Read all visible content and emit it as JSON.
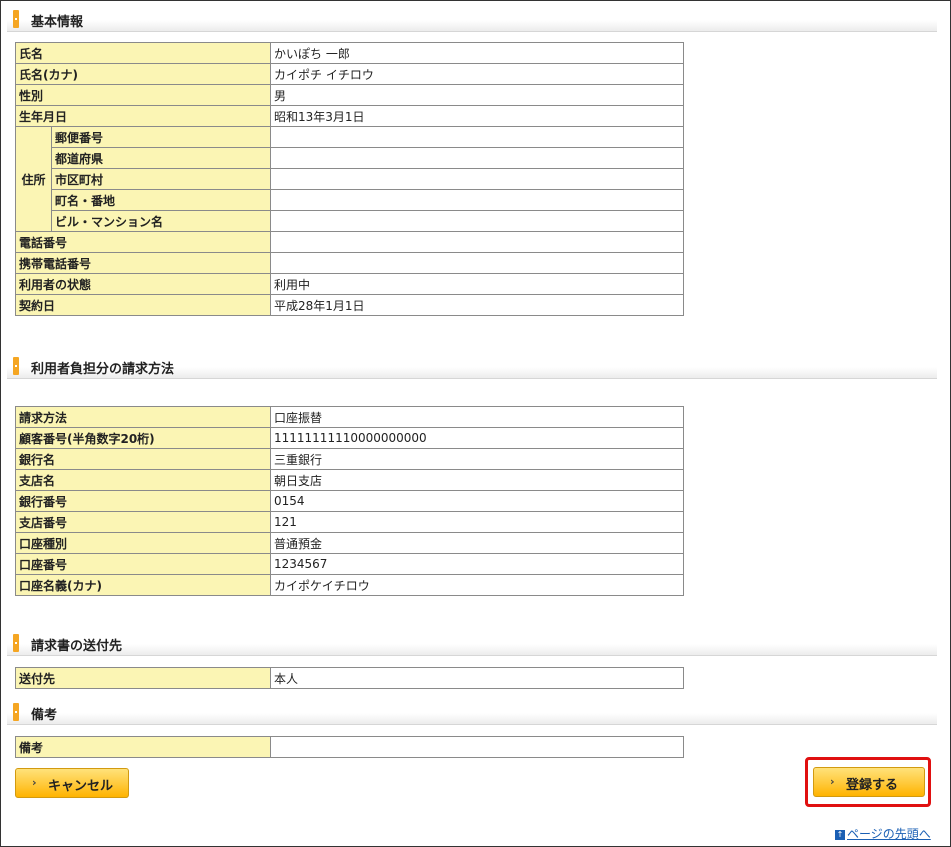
{
  "sections": {
    "basic": {
      "title": "基本情報",
      "name_label": "氏名",
      "name_value": "かいぽち 一郎",
      "kana_label": "氏名(カナ)",
      "kana_value": "カイポチ イチロウ",
      "gender_label": "性別",
      "gender_value": "男",
      "birth_label": "生年月日",
      "birth_value": "昭和13年3月1日",
      "address_label": "住所",
      "postal_label": "郵便番号",
      "postal_value": "",
      "prefecture_label": "都道府県",
      "prefecture_value": "",
      "city_label": "市区町村",
      "city_value": "",
      "town_label": "町名・番地",
      "town_value": "",
      "building_label": "ビル・マンション名",
      "building_value": "",
      "phone_label": "電話番号",
      "phone_value": "",
      "mobile_label": "携帯電話番号",
      "mobile_value": "",
      "status_label": "利用者の状態",
      "status_value": "利用中",
      "contract_label": "契約日",
      "contract_value": "平成28年1月1日"
    },
    "billing": {
      "title": "利用者負担分の請求方法",
      "method_label": "請求方法",
      "method_value": "口座振替",
      "customer_label": "顧客番号(半角数字20桁)",
      "customer_value": "11111111110000000000",
      "bank_label": "銀行名",
      "bank_value": "三重銀行",
      "branch_label": "支店名",
      "branch_value": "朝日支店",
      "bank_no_label": "銀行番号",
      "bank_no_value": "0154",
      "branch_no_label": "支店番号",
      "branch_no_value": "121",
      "account_type_label": "口座種別",
      "account_type_value": "普通預金",
      "account_no_label": "口座番号",
      "account_no_value": "1234567",
      "account_name_label": "口座名義(カナ)",
      "account_name_value": "カイポケイチロウ"
    },
    "invoice": {
      "title": "請求書の送付先",
      "dest_label": "送付先",
      "dest_value": "本人"
    },
    "remarks": {
      "title": "備考",
      "remarks_label": "備考",
      "remarks_value": ""
    }
  },
  "buttons": {
    "cancel_label": "キャンセル",
    "register_label": "登録する",
    "chevron": "›"
  },
  "footer": {
    "pagetop_label": "ページの先頭へ",
    "pagetop_icon": "↑"
  },
  "colors": {
    "label_bg": "#fbf5b4",
    "accent_bar": "#f5a623",
    "button": "#ffc93a",
    "highlight": "#e01010",
    "link": "#1a5fb4"
  }
}
